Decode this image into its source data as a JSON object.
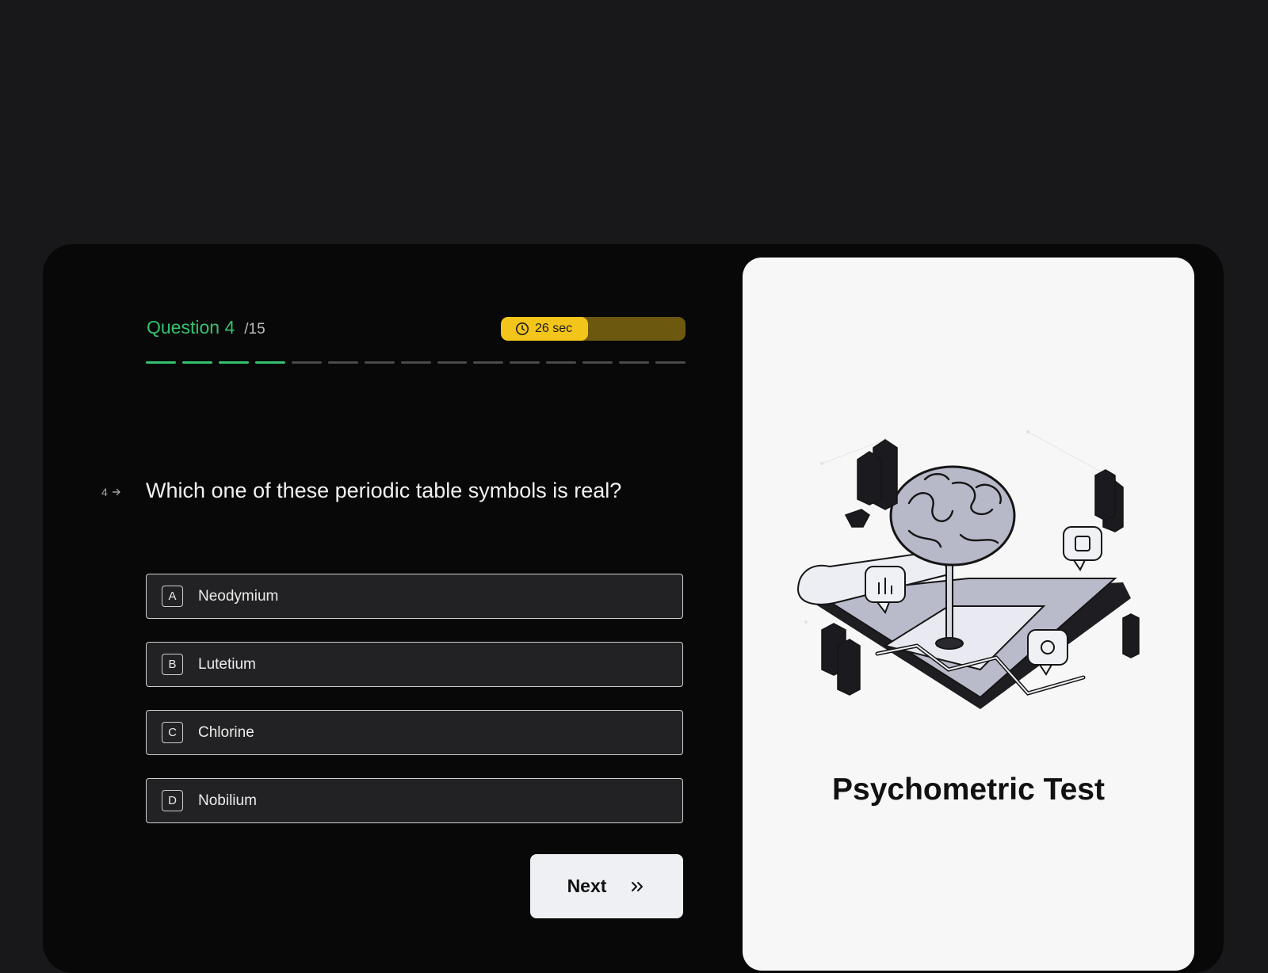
{
  "quiz": {
    "question_label": "Question 4",
    "question_total": "/15",
    "current": 4,
    "total": 15
  },
  "timer": {
    "text": "26 sec",
    "remaining_fraction": 0.47,
    "icon": "clock-icon"
  },
  "question": {
    "number": "4",
    "text": "Which one of these periodic table symbols is real?"
  },
  "answers": [
    {
      "key": "A",
      "label": "Neodymium"
    },
    {
      "key": "B",
      "label": "Lutetium"
    },
    {
      "key": "C",
      "label": "Chlorine"
    },
    {
      "key": "D",
      "label": "Nobilium"
    }
  ],
  "next_button": {
    "label": "Next",
    "icon": "double-chevron-right-icon"
  },
  "panel": {
    "title": "Psychometric Test",
    "illustration": "brain-circuit-illustration"
  },
  "colors": {
    "accent_green": "#34c26e",
    "timer_yellow": "#f3c51b",
    "timer_track": "#6d5810",
    "card_bg": "#080808",
    "page_bg": "#18181b"
  }
}
